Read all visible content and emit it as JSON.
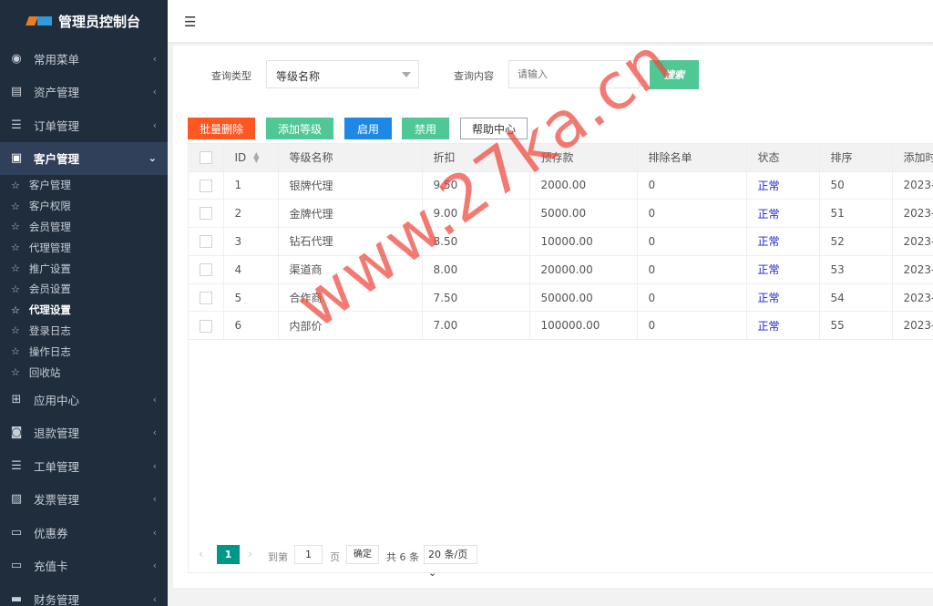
{
  "app": {
    "title": "管理员控制台"
  },
  "sidebar": {
    "menus": [
      {
        "icon": "dashboard-icon",
        "label": "常用菜单"
      },
      {
        "icon": "database-icon",
        "label": "资产管理"
      },
      {
        "icon": "list-icon",
        "label": "订单管理"
      },
      {
        "icon": "id-card-icon",
        "label": "客户管理",
        "active": true
      },
      {
        "icon": "windows-icon",
        "label": "应用中心"
      },
      {
        "icon": "money-icon",
        "label": "退款管理"
      },
      {
        "icon": "list-icon",
        "label": "工单管理"
      },
      {
        "icon": "invoice-icon",
        "label": "发票管理"
      },
      {
        "icon": "card-icon",
        "label": "优惠券"
      },
      {
        "icon": "card-icon",
        "label": "充值卡"
      },
      {
        "icon": "wallet-icon",
        "label": "财务管理"
      }
    ],
    "submenu": [
      {
        "label": "客户管理"
      },
      {
        "label": "客户权限"
      },
      {
        "label": "会员管理"
      },
      {
        "label": "代理管理"
      },
      {
        "label": "推广设置"
      },
      {
        "label": "会员设置"
      },
      {
        "label": "代理设置",
        "current": true
      },
      {
        "label": "登录日志"
      },
      {
        "label": "操作日志"
      },
      {
        "label": "回收站"
      }
    ]
  },
  "search": {
    "type_label": "查询类型",
    "type_value": "等级名称",
    "content_label": "查询内容",
    "placeholder": "请输入",
    "button": "搜索"
  },
  "toolbar": {
    "batch_delete": "批量删除",
    "add_level": "添加等级",
    "enable": "启用",
    "disable": "禁用",
    "help": "帮助中心"
  },
  "colors": {
    "danger": "#ff5722",
    "success": "#4fc896",
    "primary": "#1e88e5",
    "sidebar": "#1f2d3d",
    "pager_active": "#009688"
  },
  "table": {
    "headers": [
      "",
      "ID",
      "等级名称",
      "折扣",
      "预存款",
      "排除名单",
      "状态",
      "排序",
      "添加时间"
    ],
    "rows": [
      [
        "1",
        "银牌代理",
        "9.50",
        "2000.00",
        "0",
        "正常",
        "50",
        "2023-"
      ],
      [
        "2",
        "金牌代理",
        "9.00",
        "5000.00",
        "0",
        "正常",
        "51",
        "2023-"
      ],
      [
        "3",
        "钻石代理",
        "8.50",
        "10000.00",
        "0",
        "正常",
        "52",
        "2023-"
      ],
      [
        "4",
        "渠道商",
        "8.00",
        "20000.00",
        "0",
        "正常",
        "53",
        "2023-"
      ],
      [
        "5",
        "合作商",
        "7.50",
        "50000.00",
        "0",
        "正常",
        "54",
        "2023-"
      ],
      [
        "6",
        "内部价",
        "7.00",
        "100000.00",
        "0",
        "正常",
        "55",
        "2023-"
      ]
    ]
  },
  "pager": {
    "current": "1",
    "goto": "到第",
    "page_input": "1",
    "page": "页",
    "confirm": "确定",
    "total": "共 6 条",
    "size": "20 条/页"
  },
  "watermark": "www.27ka.cn"
}
